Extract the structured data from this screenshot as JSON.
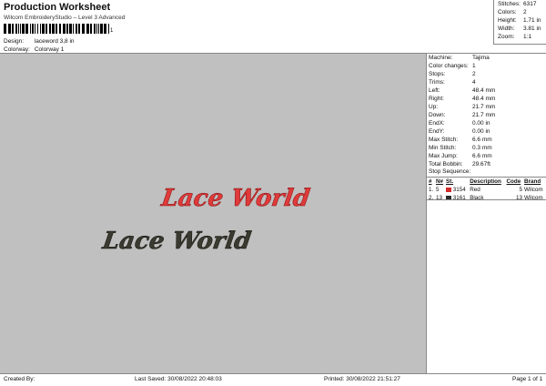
{
  "header": {
    "title": "Production Worksheet",
    "subtitle": "Wilcom EmbroideryStudio – Level 3 Advanced",
    "barcode_suffix": "1",
    "design_label": "Design:",
    "design_value": "laceword 3,8 in",
    "colorway_label": "Colorway:",
    "colorway_value": "Colorway 1"
  },
  "stats": [
    {
      "label": "Stitches:",
      "value": "6317"
    },
    {
      "label": "Colors:",
      "value": "2"
    },
    {
      "label": "Height:",
      "value": "1.71 in"
    },
    {
      "label": "Width:",
      "value": "3.81 in"
    },
    {
      "label": "Zoom:",
      "value": "1:1"
    }
  ],
  "machine": [
    {
      "label": "Machine:",
      "value": "Tajima"
    },
    {
      "label": "Color changes:",
      "value": "1"
    },
    {
      "label": "Stops:",
      "value": "2"
    },
    {
      "label": "Trims:",
      "value": "4"
    },
    {
      "label": "Left:",
      "value": "48.4 mm"
    },
    {
      "label": "Right:",
      "value": "48.4 mm"
    },
    {
      "label": "Up:",
      "value": "21.7 mm"
    },
    {
      "label": "Down:",
      "value": "21.7 mm"
    },
    {
      "label": "EndX:",
      "value": "0.00 in"
    },
    {
      "label": "EndY:",
      "value": "0.00 in"
    },
    {
      "label": "Max Stitch:",
      "value": "6.6 mm"
    },
    {
      "label": "Min Stitch:",
      "value": "0.3 mm"
    },
    {
      "label": "Max Jump:",
      "value": "6.6 mm"
    },
    {
      "label": "Total Bobbin:",
      "value": "29.67ft"
    }
  ],
  "stop_sequence": {
    "title": "Stop Sequence:",
    "columns": [
      "#",
      "N#",
      "St.",
      "Description",
      "Code",
      "Brand"
    ],
    "rows": [
      {
        "num": "1.",
        "n": "5",
        "color": "#d42a2a",
        "st": "3154",
        "desc": "Red",
        "code": "5",
        "brand": "Wilcom"
      },
      {
        "num": "2.",
        "n": "13",
        "color": "#2a2a2a",
        "st": "3161",
        "desc": "Black",
        "code": "13",
        "brand": "Wilcom"
      }
    ]
  },
  "design": {
    "text": "Lace World",
    "colors": {
      "front": "#e03a3a",
      "front_outline": "#8a1616",
      "back": "#3a3a30",
      "back_outline": "#1a1a14"
    }
  },
  "footer": {
    "created": "Created By:",
    "saved": "Last Saved: 30/08/2022 20:48:03",
    "printed": "Printed: 30/08/2022 21:51:27",
    "page": "Page 1 of 1"
  }
}
